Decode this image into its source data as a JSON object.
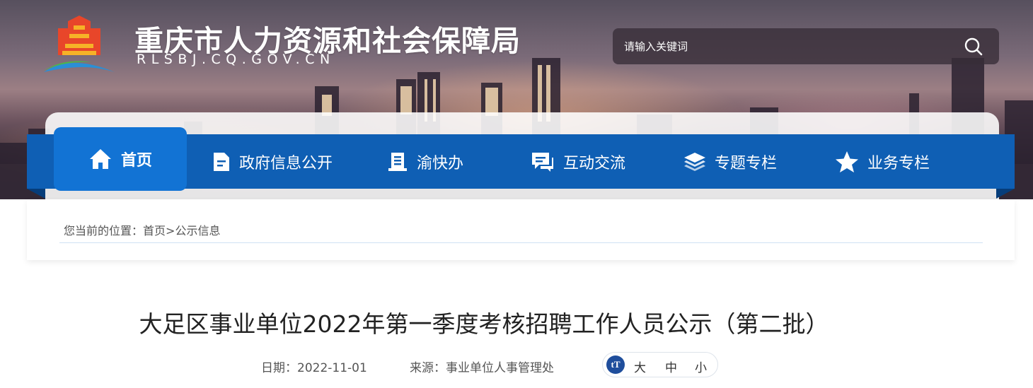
{
  "site": {
    "title": "重庆市人力资源和社会保障局",
    "domain": "RLSBJ.CQ.GOV.CN"
  },
  "search": {
    "placeholder": "请输入关键词",
    "icon": "search-icon"
  },
  "nav": {
    "items": [
      {
        "label": "首页",
        "icon": "home-icon",
        "active": true
      },
      {
        "label": "政府信息公开",
        "icon": "document-icon"
      },
      {
        "label": "渝快办",
        "icon": "list-doc-icon"
      },
      {
        "label": "互动交流",
        "icon": "chat-icon"
      },
      {
        "label": "专题专栏",
        "icon": "layers-icon"
      },
      {
        "label": "业务专栏",
        "icon": "star-icon"
      }
    ]
  },
  "breadcrumb": {
    "prefix": "您当前的位置：",
    "home": "首页",
    "separator": ">",
    "current": "公示信息"
  },
  "article": {
    "title": "大足区事业单位2022年第一季度考核招聘工作人员公示（第二批）",
    "date_label": "日期：",
    "date": "2022-11-01",
    "source_label": "来源：",
    "source": "事业单位人事管理处"
  },
  "font_size": {
    "icon_text": "tT",
    "options": [
      "大",
      "中",
      "小"
    ]
  },
  "colors": {
    "nav_bg": "#0f5fb4",
    "nav_active": "#1273d4",
    "font_icon": "#1f4e9c"
  }
}
